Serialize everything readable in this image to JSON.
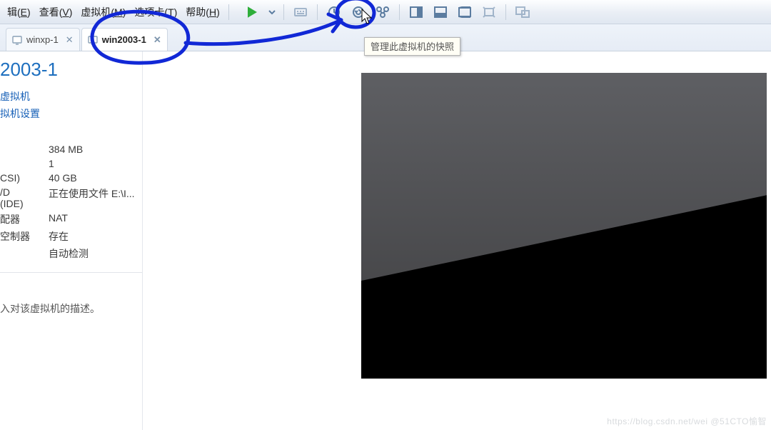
{
  "menu": {
    "edit": {
      "text": "辑",
      "key": "E"
    },
    "view": {
      "text": "查看",
      "key": "V"
    },
    "vm": {
      "text": "虚拟机",
      "key": "M"
    },
    "tabs": {
      "text": "选项卡",
      "key": "T"
    },
    "help": {
      "text": "帮助",
      "key": "H"
    }
  },
  "tooltip": "管理此虚拟机的快照",
  "tabs": [
    {
      "label": "winxp-1",
      "active": false
    },
    {
      "label": "win2003-1",
      "active": true
    }
  ],
  "page": {
    "title": "2003-1",
    "links": {
      "power": "虚拟机",
      "settings": "拟机设置"
    },
    "spec_labels": {
      "memory": "",
      "cpu": "",
      "disk": "CSI)",
      "dvd": "/D (IDE)",
      "net": "配器",
      "usb": "空制器",
      "misc": ""
    },
    "specs": {
      "memory": "384 MB",
      "cpu": "1",
      "disk": "40 GB",
      "dvd": "正在使用文件 E:\\I...",
      "net": "NAT",
      "usb": "存在",
      "misc": "自动检测"
    },
    "description": "入对该虚拟机的描述。"
  },
  "watermark": "https://blog.csdn.net/wei @51CTO愉智"
}
